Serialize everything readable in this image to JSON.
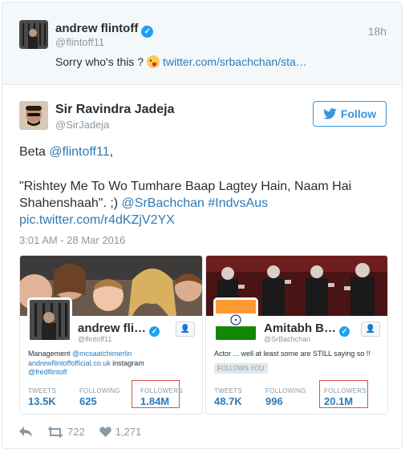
{
  "reply": {
    "name": "andrew flintoff",
    "handle": "@flintoff11",
    "time": "18h",
    "text": "Sorry who's this ?",
    "link": "twitter.com/srbachchan/sta…"
  },
  "tweet": {
    "name": "Sir Ravindra Jadeja",
    "handle": "@SirJadeja",
    "follow_label": "Follow",
    "line1_prefix": "Beta ",
    "line1_mention": "@flintoff11",
    "line1_suffix": ",",
    "line2": "\"Rishtey Me To Wo Tumhare Baap Lagtey Hain, Naam Hai",
    "line3_text": "Shahenshaah\". ;) ",
    "line3_mention": "@SrBachchan",
    "line3_hashtag": "#IndvsAus",
    "line4_link": "pic.twitter.com/r4dKZjV2YX",
    "timestamp": "3:01 AM - 28 Mar 2016"
  },
  "card_left": {
    "name": "andrew fli…",
    "handle": "@flintoff11",
    "bio_line1_prefix": "Management ",
    "bio_line1_mention": "@mcsaatchimerlin",
    "bio_line2_link": "andrewflintoffofficial.co.uk",
    "bio_line2_suffix": " instagram",
    "bio_line3_mention": "@fredflintoff",
    "tweets_label": "TWEETS",
    "tweets_value": "13.5K",
    "following_label": "FOLLOWING",
    "following_value": "625",
    "followers_label": "FOLLOWERS",
    "followers_value": "1.84M"
  },
  "card_right": {
    "name": "Amitabh B…",
    "handle": "@SrBachchan",
    "bio": "Actor ... well at least some are STILL saying so !!",
    "follows_you": "FOLLOWS YOU",
    "tweets_label": "TWEETS",
    "tweets_value": "48.7K",
    "following_label": "FOLLOWING",
    "following_value": "996",
    "followers_label": "FOLLOWERS",
    "followers_value": "20.1M"
  },
  "actions": {
    "retweets": "722",
    "likes": "1,271"
  },
  "icons": {
    "verified": "verified-badge-icon",
    "bird": "twitter-bird-icon",
    "reply": "reply-icon",
    "retweet": "retweet-icon",
    "like": "heart-icon",
    "emoji": "tongue-wink-emoji-icon",
    "follow_small": "follow-person-icon"
  },
  "colors": {
    "link": "#2b7bb9",
    "muted": "#8899a6",
    "follow": "#3b94d9",
    "verified": "#1da1f2",
    "highlight_box": "#d9534f"
  }
}
